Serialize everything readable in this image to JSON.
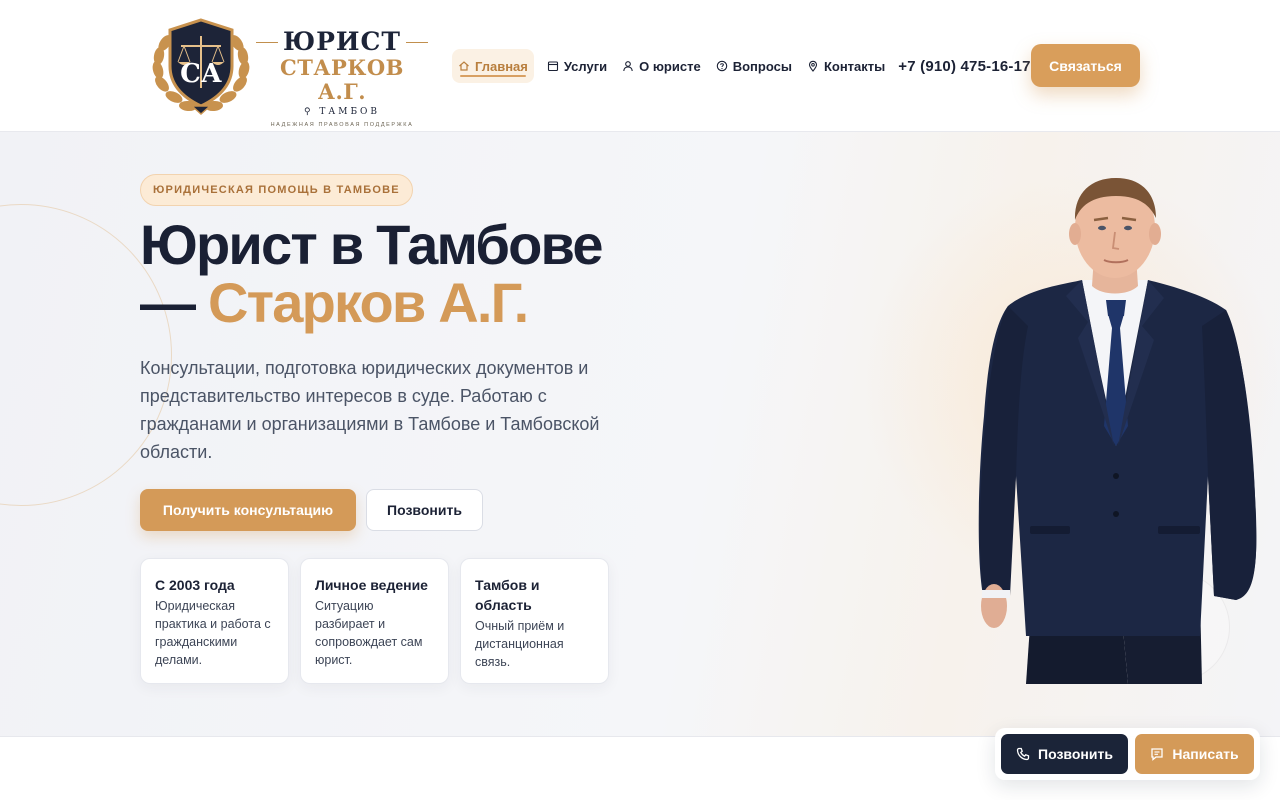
{
  "logo": {
    "line1": "ЮРИСТ",
    "line2": "СТАРКОВ А.Г.",
    "city": "ТАМБОВ",
    "tagline": "надежная правовая поддержка",
    "emblem_letters": "СА"
  },
  "nav": {
    "items": [
      {
        "label": "Главная",
        "icon": "home-icon",
        "active": true
      },
      {
        "label": "Услуги",
        "icon": "list-icon",
        "active": false
      },
      {
        "label": "О юристе",
        "icon": "user-icon",
        "active": false
      },
      {
        "label": "Вопросы",
        "icon": "question-icon",
        "active": false
      },
      {
        "label": "Контакты",
        "icon": "location-pin-icon",
        "active": false
      }
    ],
    "phone": "+7 (910) 475-16-17",
    "cta": "Связаться"
  },
  "hero": {
    "badge": "Юридическая помощь в Тамбове",
    "title_line1": "Юрист в Тамбове",
    "title_dash": "— ",
    "title_accent": "Старков А.Г.",
    "lead": "Консультации, подготовка юридических документов и представительство интересов в суде. Работаю с гражданами и организациями в Тамбове и Тамбовской области.",
    "primary_button": "Получить консультацию",
    "secondary_button": "Позвонить",
    "cards": [
      {
        "title": "С 2003 года",
        "text": "Юридическая практика и работа с гражданскими делами."
      },
      {
        "title": "Личное ведение",
        "text": "Ситуацию разбирает и сопровождает сам юрист."
      },
      {
        "title": "Тамбов и область",
        "text": "Очный приём и дистанционная связь."
      }
    ]
  },
  "floating": {
    "call": "Позвонить",
    "write": "Написать"
  },
  "colors": {
    "accent": "#d49a58",
    "dark": "#1b2438",
    "text": "#1c2235"
  }
}
